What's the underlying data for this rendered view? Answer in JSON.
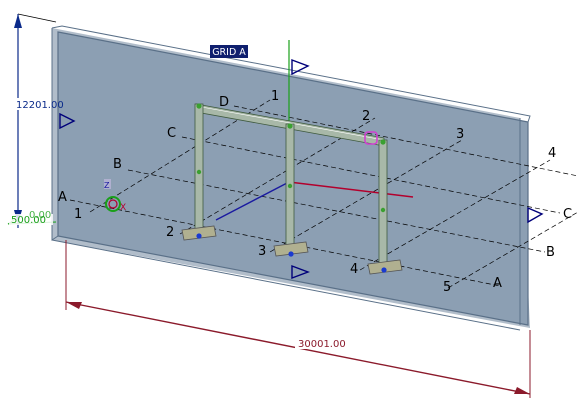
{
  "view": {
    "plane_label": "GRID A",
    "dimensions": {
      "height": "12201.00",
      "width": "30001.00",
      "left_small": "500.00",
      "left_small_overlap": "0.00"
    },
    "axis_labels": {
      "z": "Z",
      "x": "X"
    },
    "grid_letters_left": [
      "A",
      "B",
      "C",
      "D"
    ],
    "grid_letters_right": [
      "A",
      "B",
      "C"
    ],
    "grid_numbers_top": [
      "1",
      "2",
      "3",
      "4"
    ],
    "grid_numbers_bottom": [
      "1",
      "2",
      "3",
      "4",
      "5"
    ],
    "colors": {
      "plane_fill": "#8c9fb3",
      "plane_edge": "#5a7088",
      "dimension_red": "#8b1a2b",
      "axis_green": "#1aa01a",
      "axis_red": "#b3002d",
      "axis_blue": "#1a1aa0",
      "steel_green": "#7fa060",
      "highlight_magenta": "#d040d0"
    }
  }
}
